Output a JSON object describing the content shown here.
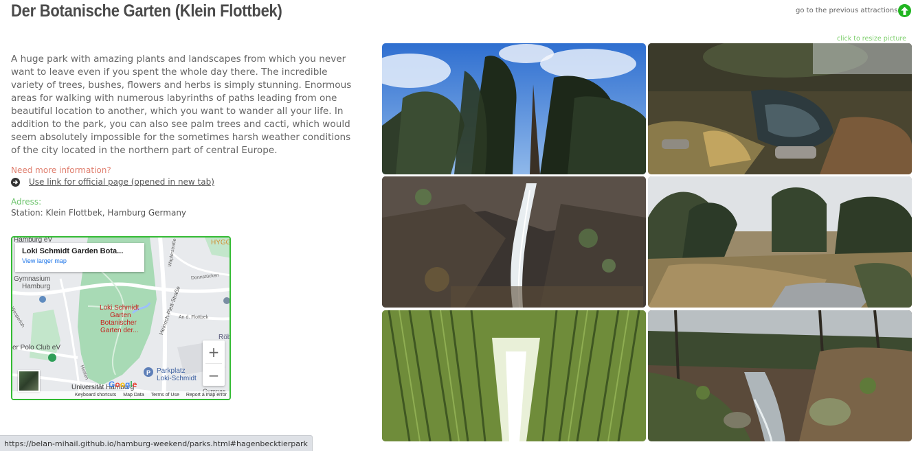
{
  "page": {
    "title": "Der Botanische Garten (Klein Flottbek)",
    "previous_attractions_label": "go to the previous attractions",
    "resize_hint": "click to resize picture",
    "accent_color": "#21b521"
  },
  "content": {
    "description": "A huge park with amazing plants and landscapes from which you never want to leave even if you spent the whole day there. The incredible variety of trees, bushes, flowers and herbs is simply stunning. Enormous areas for walking with numerous labyrinths of paths leading from one beautiful location to another, which you want to wander all your life. In addition to the park, you can also see palm trees and cacti, which would seem absolutely impossible for the sometimes harsh weather conditions of the city located in the northern part of central Europe.",
    "need_info": "Need more information?",
    "official_link": "Use link for official page (opened in new tab)",
    "address_label": "Adress:",
    "address_value": "Station: Klein Flottbek, Hamburg Germany"
  },
  "map": {
    "card_title": "Loki Schmidt Garden Bota...",
    "view_larger": "View larger map",
    "labels": {
      "hamburg_ev": "Hamburg eV",
      "hygg": "HYGG",
      "gymnasium": "Gymnasium",
      "hamburg": "Hamburg",
      "wesperloh": "Wesperloh",
      "waplerstrasse": "Waplerstraße",
      "donnstuecken": "Donnstücken",
      "heinrich": "Heinrich-Plett-Straße",
      "am_flottbek": "An d. Flottbek",
      "garden_name_1": "Loki Schmidt",
      "garden_name_2": "Garten",
      "garden_name_3": "Botanischer",
      "garden_name_4": "Garten der...",
      "polo_club": "er Polo Club eV",
      "rob": "Röb",
      "parking_1": "Parkplatz",
      "parking_2": "Loki-Schmidt",
      "hesten": "Hesten",
      "university": "Universität Hamburg",
      "gymnas": "Gymnas"
    },
    "zoom_in": "+",
    "zoom_out": "−",
    "footer": [
      "Keyboard shortcuts",
      "Map Data",
      "Terms of Use",
      "Report a map error"
    ],
    "google_letters": [
      "G",
      "o",
      "o",
      "g",
      "l",
      "e"
    ],
    "google_colors": [
      "#4285F4",
      "#EA4335",
      "#FBBC05",
      "#4285F4",
      "#34A853",
      "#EA4335"
    ]
  },
  "gallery": {
    "photos": [
      {
        "subject": "Tall conifers against blue sky"
      },
      {
        "subject": "Pond with grasses and stones"
      },
      {
        "subject": "Small waterfall over rocks"
      },
      {
        "subject": "Garden landscape with shrubs and path"
      },
      {
        "subject": "Bamboo tunnel path"
      },
      {
        "subject": "Stream in wooded bamboo area"
      }
    ]
  },
  "status_bar": {
    "url": "https://belan-mihail.github.io/hamburg-weekend/parks.html#hagenbecktierpark"
  }
}
